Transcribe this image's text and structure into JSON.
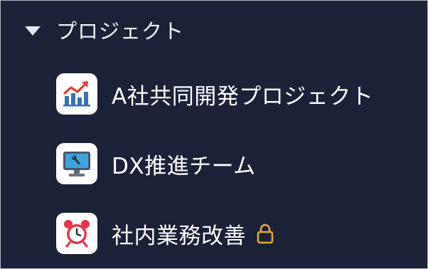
{
  "section": {
    "title": "プロジェクト",
    "caret_icon": "triangle-down"
  },
  "projects": [
    {
      "label": "A社共同開発プロジェクト",
      "icon": "chart-increasing",
      "locked": false
    },
    {
      "label": "DX推進チーム",
      "icon": "desktop-computer-wrench",
      "locked": false
    },
    {
      "label": "社内業務改善",
      "icon": "alarm-clock",
      "locked": true
    }
  ],
  "colors": {
    "background": "#1b2238",
    "text": "#ffffff",
    "lock": "#e0a83e",
    "icon_tile": "#ffffff"
  }
}
